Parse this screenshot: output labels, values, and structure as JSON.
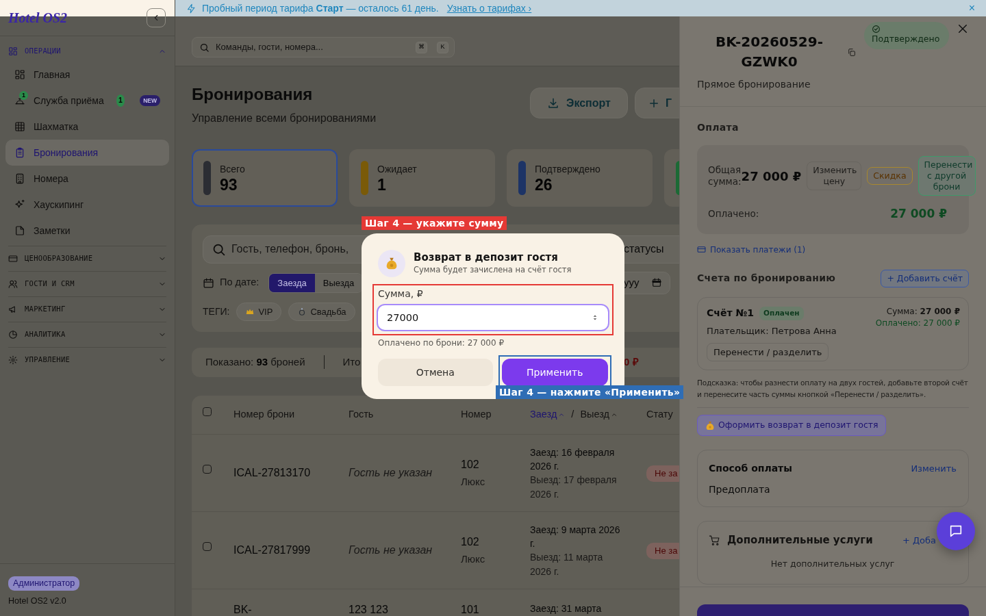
{
  "sidebar": {
    "logo": "Hotel OS2",
    "sections": [
      {
        "title": "ОПЕРАЦИИ",
        "expanded": true,
        "items": [
          {
            "label": "Главная",
            "selected": false
          },
          {
            "label": "Служба приёма",
            "selected": false,
            "icon_badge": "1",
            "count": "1",
            "tag": "NEW"
          },
          {
            "label": "Шахматка",
            "selected": false
          },
          {
            "label": "Бронирования",
            "selected": true
          },
          {
            "label": "Номера",
            "selected": false
          },
          {
            "label": "Хаускипинг",
            "selected": false
          },
          {
            "label": "Заметки",
            "selected": false
          }
        ]
      },
      {
        "title": "ЦЕНООБРАЗОВАНИЕ",
        "expanded": false
      },
      {
        "title": "ГОСТИ И CRM",
        "expanded": false
      },
      {
        "title": "МАРКЕТИНГ",
        "expanded": false
      },
      {
        "title": "АНАЛИТИКА",
        "expanded": false
      },
      {
        "title": "УПРАВЛЕНИЕ",
        "expanded": false
      }
    ],
    "footer": {
      "role": "Администратор",
      "version": "Hotel OS2 v2.0"
    }
  },
  "banner": {
    "text": "Пробный период тарифа **Старт** — осталось 61 день.",
    "link": "Узнать о тарифах ›",
    "close": "×"
  },
  "topbar": {
    "search_placeholder": "Команды, гости, номера...",
    "shortcut_keys": [
      "⌘",
      "K"
    ]
  },
  "page": {
    "title": "Бронирования",
    "subtitle": "Управление всеми бронированиями",
    "buttons": [
      {
        "label": "Экспорт",
        "kind": "export"
      },
      {
        "label": "Г",
        "kind": "add"
      }
    ]
  },
  "stats": [
    {
      "label": "Всего",
      "value": "93",
      "color": "#2b2d33",
      "selected": true
    },
    {
      "label": "Ожидает",
      "value": "1",
      "color": "#7a5a08",
      "selected": false
    },
    {
      "label": "Подтверждено",
      "value": "26",
      "color": "#1d3466",
      "selected": false
    },
    {
      "color": "#1b6a35",
      "selected": false
    }
  ],
  "filters": {
    "search_placeholder": "Гость, телефон, бронь,",
    "status_select": "статусы",
    "date_label": "По дате:",
    "date_modes": [
      {
        "label": "Заезда",
        "selected": true
      },
      {
        "label": "Выезда",
        "selected": false
      }
    ],
    "date_placeholder": "yyy",
    "tags_label": "ТЕГИ:",
    "tags": [
      "VIP",
      "Свадьба"
    ]
  },
  "summary": {
    "shown": "Показано: **93** броней",
    "total": "Ито",
    "amount": "0 ₽"
  },
  "table": {
    "checked_all": false,
    "columns": [
      "Номер брони",
      "Гость",
      "Номер"
    ],
    "date_column": {
      "separator": "/",
      "sorts": [
        {
          "label": "Заезд",
          "selected": true
        },
        {
          "label": "Выезд",
          "selected": false
        }
      ]
    },
    "status_column": "Стату",
    "rows": [
      {
        "checked": false,
        "booking": "ICAL-27813170",
        "guest": "Гость не указан",
        "guest_missing": true,
        "room": "102",
        "room_type": "Люкс",
        "check_in": "Заезд: 16 февраля 2026 г.",
        "check_out": "Выезд: 17 февраля 2026 г.",
        "status": "Не за"
      },
      {
        "checked": false,
        "booking": "ICAL-27817999",
        "guest": "Гость не указан",
        "guest_missing": true,
        "room": "102",
        "room_type": "Люкс",
        "check_in": "Заезд: 9 марта 2026 г.",
        "check_out": "Выезд: 11 марта 2026 г.",
        "status": "Не за"
      },
      {
        "booking": "BK-",
        "guest": "123 123",
        "guest_missing": false,
        "room": "101",
        "check_in": "Заезд: 31 марта"
      }
    ]
  },
  "drawer": {
    "title": "BK-20260529-GZWK0",
    "status": "Подтверждено",
    "subtitle": "Прямое бронирование",
    "payment": {
      "heading": "Оплата",
      "total_label": "Общая сумма:",
      "total": "27 000 ₽",
      "actions": [
        {
          "label": "Изменить цену",
          "kind": "neutral"
        },
        {
          "label": "Скидка",
          "kind": "warning"
        },
        {
          "label": "Перенести с другой брони",
          "kind": "success"
        }
      ],
      "paid_label": "Оплачено:",
      "paid": "27 000 ₽"
    },
    "payments_link": "Показать платежи (1)",
    "invoices": {
      "heading": "Счета по бронированию",
      "add": "+ Добавить счёт",
      "items": [
        {
          "title": "Счёт №1",
          "status": "Оплачен",
          "payer": "Плательщик: Петрова Анна",
          "sum": "Сумма: **27 000 ₽**",
          "paid": "Оплачено: 27 000 ₽",
          "action": "Перенести / разделить"
        }
      ],
      "hint": "Подсказка: чтобы разнести оплату на двух гостей, добавьте второй счёт и перенесите часть суммы кнопкой «Перенести / разделить»."
    },
    "refund_button": "Оформить возврат в депозит гостя",
    "payment_method": {
      "heading": "Способ оплаты",
      "edit": "Изменить",
      "value": "Предоплата"
    },
    "extras": {
      "heading": "Дополнительные услуги",
      "add": "+ Доба",
      "empty": "Нет дополнительных услуг"
    }
  },
  "modal": {
    "title": "Возврат в депозит гостя",
    "subtitle": "Сумма будет зачислена на счёт гостя",
    "field_label": "Сумма, ₽",
    "value": "27000",
    "hint": "Оплачено по брони: 27 000 ₽",
    "buttons": [
      {
        "label": "Отмена",
        "kind": "secondary"
      },
      {
        "label": "Применить",
        "kind": "primary"
      }
    ]
  },
  "tour": [
    {
      "text": "Шаг 4 — укажите сумму",
      "color": "#e53935"
    },
    {
      "text": "Шаг 4 — нажмите «Применить»",
      "color": "#2f6db5"
    }
  ]
}
